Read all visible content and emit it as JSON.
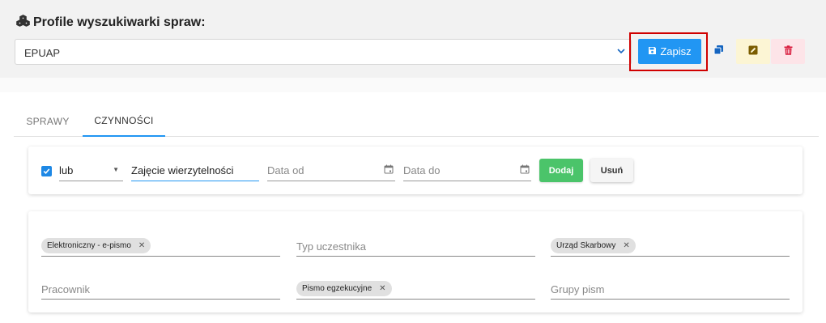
{
  "header": {
    "title": "Profile wyszukiwarki spraw:",
    "profile_value": "EPUAP",
    "save_label": "Zapisz"
  },
  "tabs": [
    {
      "label": "SPRAWY",
      "active": false
    },
    {
      "label": "CZYNNOŚCI",
      "active": true
    }
  ],
  "filter": {
    "enabled": true,
    "operator": "lub",
    "activity_value": "Zajęcie wierzytelności",
    "date_from_placeholder": "Data od",
    "date_to_placeholder": "Data do",
    "add_label": "Dodaj",
    "remove_label": "Usuń"
  },
  "criteria": {
    "kind_chip": "Elektroniczny - e-pismo",
    "participant_type_placeholder": "Typ uczestnika",
    "office_chip": "Urząd Skarbowy",
    "employee_placeholder": "Pracownik",
    "letter_chip": "Pismo egzekucyjne",
    "letter_groups_placeholder": "Grupy pism"
  },
  "colors": {
    "primary": "#2196f3",
    "success": "#4bc46a",
    "highlight": "#d00000",
    "edit_bg": "#fcf5d4",
    "delete_bg": "#fde4e8"
  },
  "icons": [
    "cubes-icon",
    "chevron-down-icon",
    "floppy-disk-icon",
    "copy-icon",
    "edit-icon",
    "trash-icon",
    "calendar-icon",
    "check-icon",
    "close-icon"
  ]
}
